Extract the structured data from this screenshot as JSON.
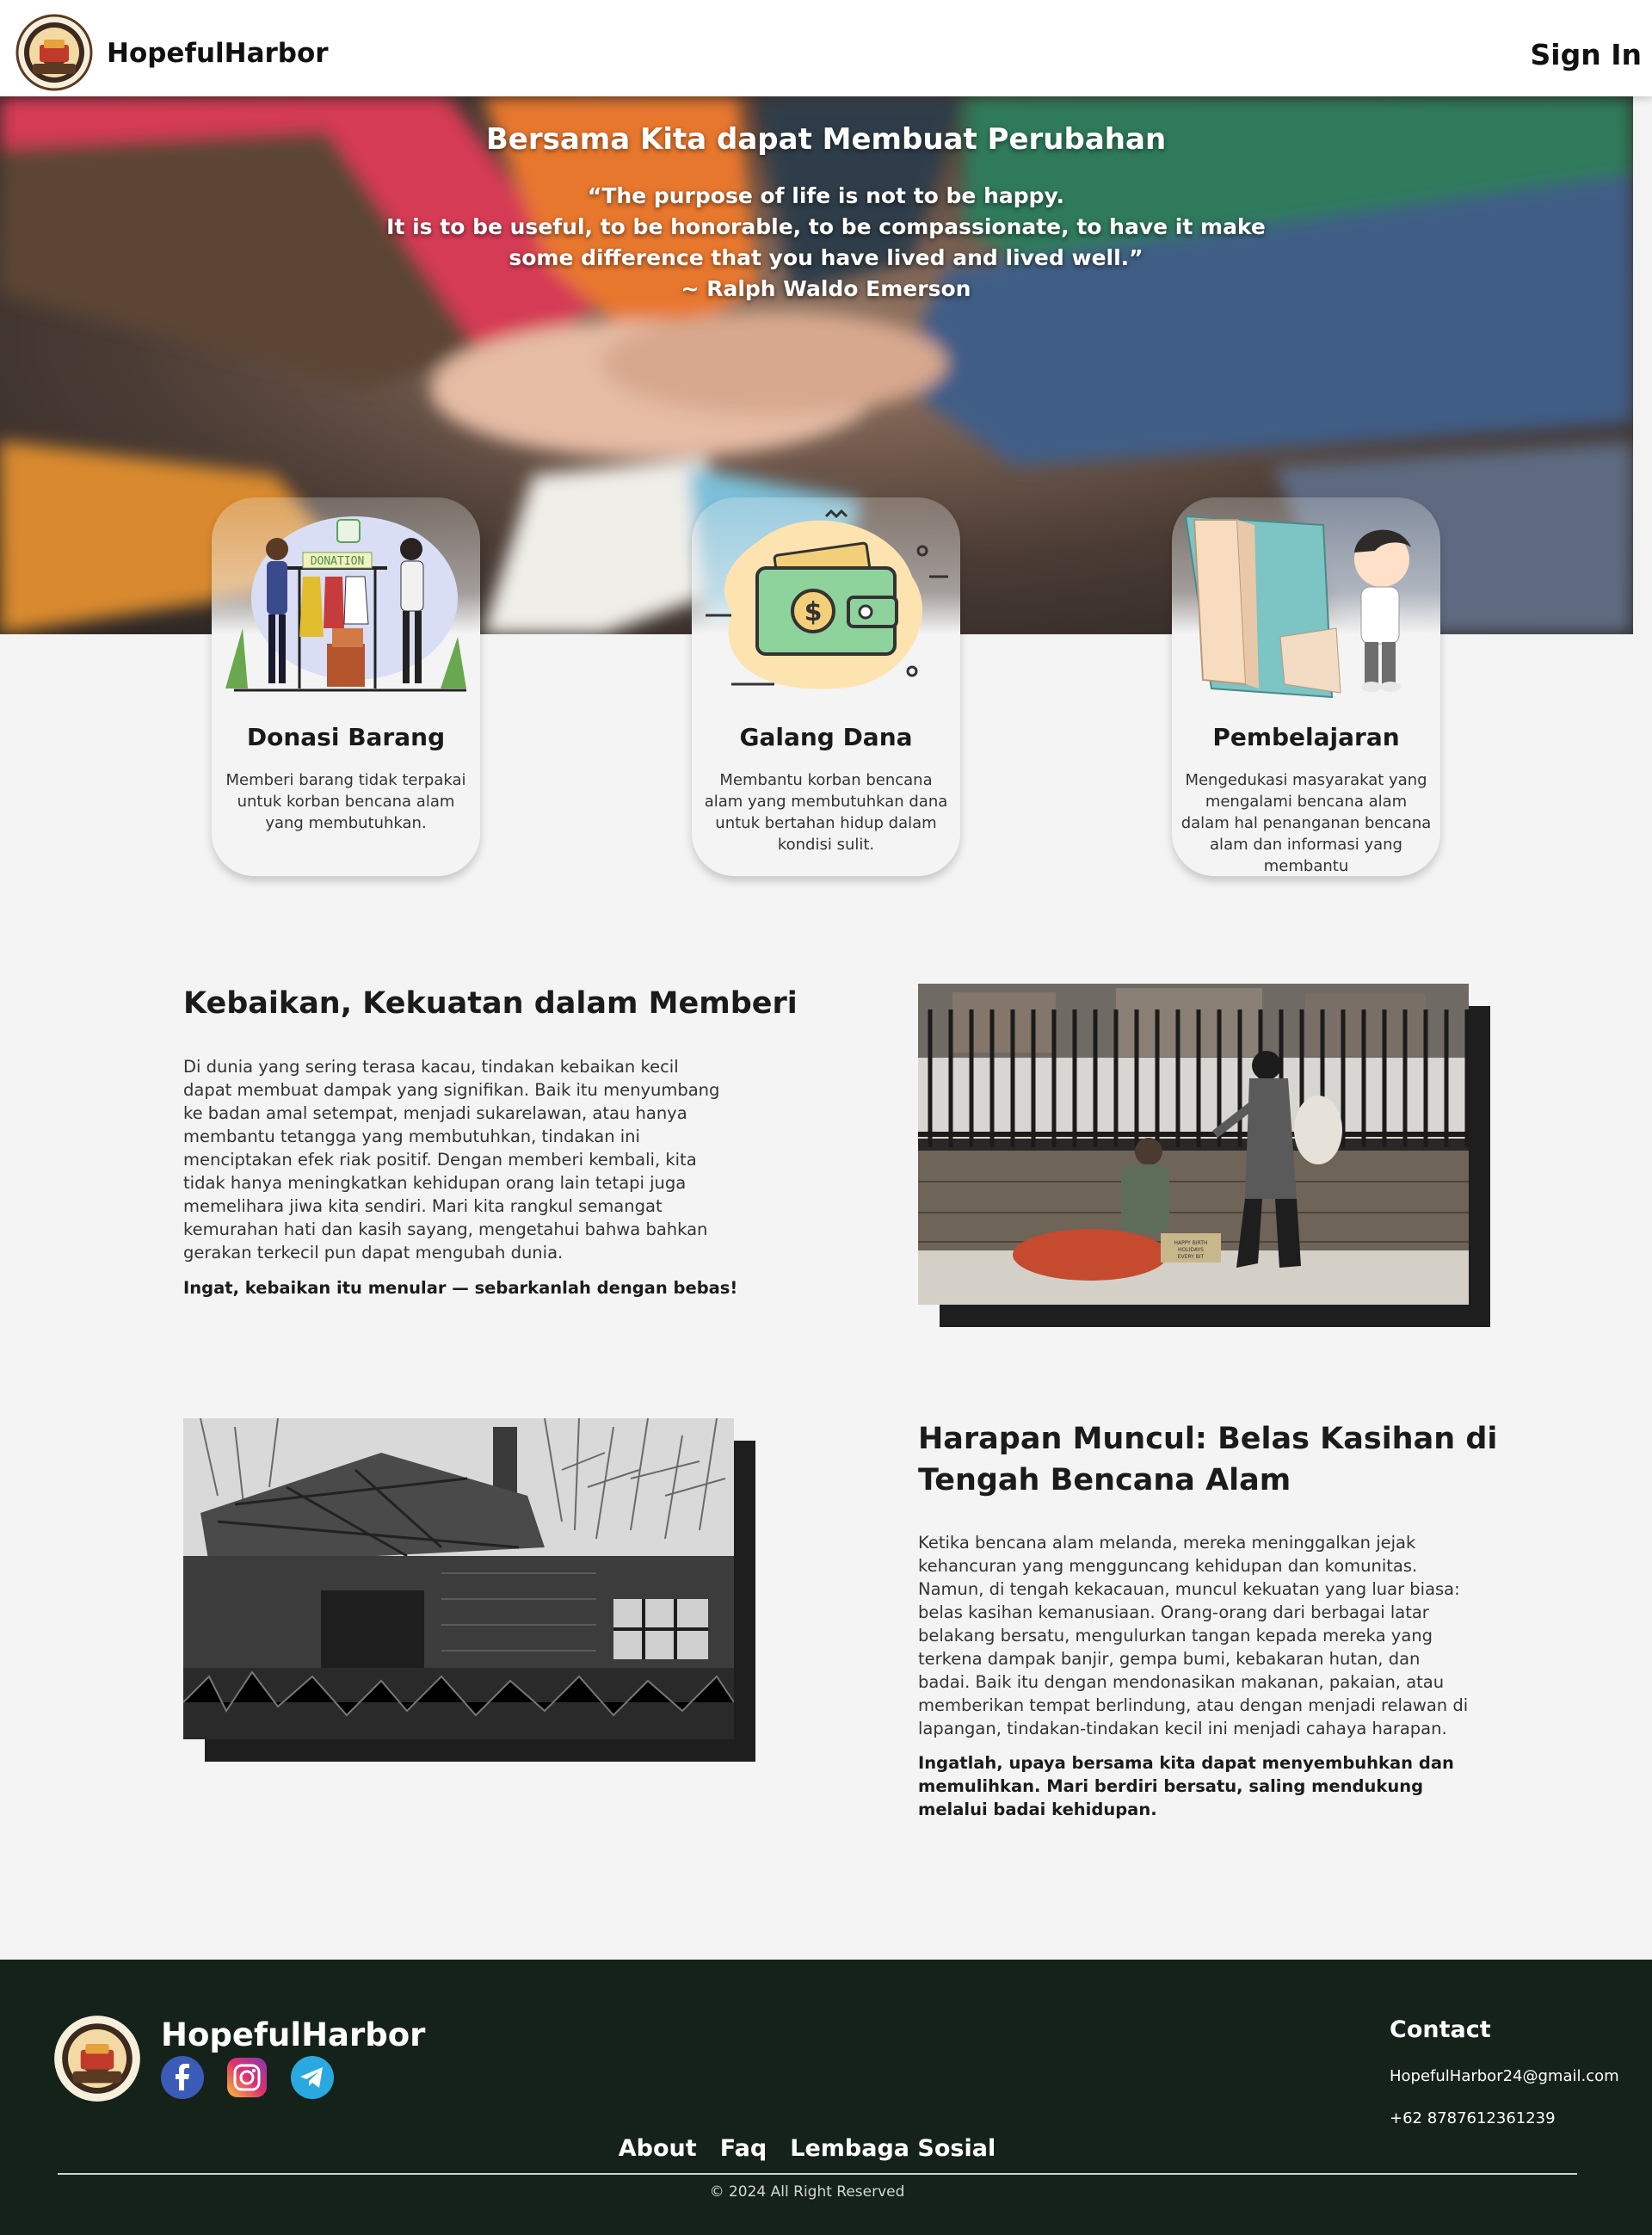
{
  "nav": {
    "brand": "HopefulHarbor",
    "sign_in": "Sign In"
  },
  "hero": {
    "title": "Bersama Kita dapat Membuat Perubahan",
    "quote_lines": [
      "“The purpose of life is not to be happy.",
      "It is to be useful, to be honorable, to be compassionate, to have it make",
      "some difference that you have lived and lived well.”",
      "~ Ralph Waldo Emerson"
    ]
  },
  "cards": [
    {
      "title": "Donasi Barang",
      "desc": "Memberi barang tidak terpakai untuk korban bencana alam yang membutuhkan.",
      "icon": "donation-rack-illustration",
      "illus_text": "DONATION"
    },
    {
      "title": "Galang Dana",
      "desc": "Membantu korban bencana alam yang membutuhkan dana untuk bertahan hidup dalam kondisi sulit.",
      "icon": "wallet-money-illustration"
    },
    {
      "title": "Pembelajaran",
      "desc": "Mengedukasi masyarakat yang mengalami bencana alam dalam hal penanganan bencana alam dan informasi yang membantu",
      "icon": "child-reading-book-illustration"
    }
  ],
  "article1": {
    "title": "Kebaikan, Kekuatan dalam Memberi",
    "body": "Di dunia yang sering terasa kacau, tindakan kebaikan kecil dapat membuat dampak yang signifikan. Baik itu menyumbang ke badan amal setempat, menjadi sukarelawan, atau hanya membantu tetangga yang membutuhkan, tindakan ini menciptakan efek riak positif. Dengan memberi kembali, kita tidak hanya meningkatkan kehidupan orang lain tetapi juga memelihara jiwa kita sendiri. Mari kita rangkul semangat kemurahan hati dan kasih sayang, mengetahui bahwa bahkan gerakan terkecil pun dapat mengubah dunia.",
    "emphasis": "Ingat, kebaikan itu menular — sebarkanlah dengan bebas!",
    "photo_sign": [
      "HAPPY BIRTH",
      "HOLIDAYS",
      "EVERY BIT",
      "HELPS"
    ]
  },
  "article2": {
    "title": "Harapan Muncul: Belas Kasihan di Tengah Bencana Alam",
    "body": "Ketika bencana alam melanda, mereka meninggalkan jejak kehancuran yang mengguncang kehidupan dan komunitas. Namun, di tengah kekacauan, muncul kekuatan yang luar biasa: belas kasihan kemanusiaan. Orang-orang dari berbagai latar belakang bersatu, mengulurkan tangan kepada mereka yang terkena dampak banjir, gempa bumi, kebakaran hutan, dan badai. Baik itu dengan mendonasikan makanan, pakaian, atau memberikan tempat berlindung, atau dengan menjadi relawan di lapangan, tindakan-tindakan kecil ini menjadi cahaya harapan.",
    "emphasis": "Ingatlah, upaya bersama kita dapat menyembuhkan dan memulihkan. Mari berdiri bersatu, saling mendukung melalui badai kehidupan."
  },
  "footer": {
    "brand": "HopefulHarbor",
    "contact_title": "Contact",
    "email": "HopefulHarbor24@gmail.com",
    "phone": "+62 8787612361239",
    "links": [
      "About",
      "Faq",
      "Lembaga Sosial"
    ],
    "copyright": "© 2024 All Right Reserved",
    "social": [
      "facebook-icon",
      "instagram-icon",
      "telegram-icon"
    ]
  },
  "colors": {
    "footer_bg": "#14221a",
    "navbar_bg": "#ffffff",
    "page_bg": "#f4f4f4",
    "shadow_block": "#1e1e1e"
  }
}
